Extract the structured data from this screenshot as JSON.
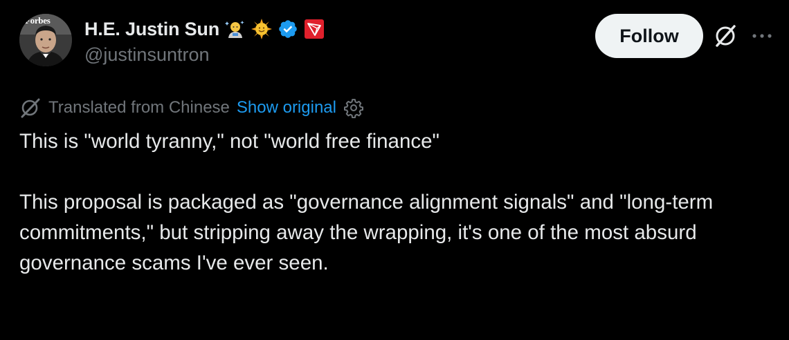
{
  "author": {
    "display_name": "H.E. Justin Sun",
    "handle": "@justinsuntron",
    "avatar_text": "Forbes",
    "badges": [
      "astronaut-emoji-icon",
      "sun-emoji-icon",
      "verified-icon",
      "tron-logo-icon"
    ]
  },
  "actions": {
    "follow_label": "Follow"
  },
  "translation": {
    "label": "Translated from Chinese",
    "show_original_label": "Show original"
  },
  "tweet": {
    "paragraphs": [
      "This is \"world tyranny,\" not \"world free finance\"",
      "This proposal is packaged as \"governance alignment signals\" and \"long-term commitments,\" but stripping away the wrapping, it's one of the most absurd governance scams I've ever seen."
    ]
  },
  "colors": {
    "background": "#000000",
    "text_primary": "#e7e9ea",
    "text_secondary": "#71767b",
    "link": "#1d9bf0",
    "follow_bg": "#eff3f4",
    "verified": "#1d9bf0",
    "tron_red": "#e0202c"
  }
}
